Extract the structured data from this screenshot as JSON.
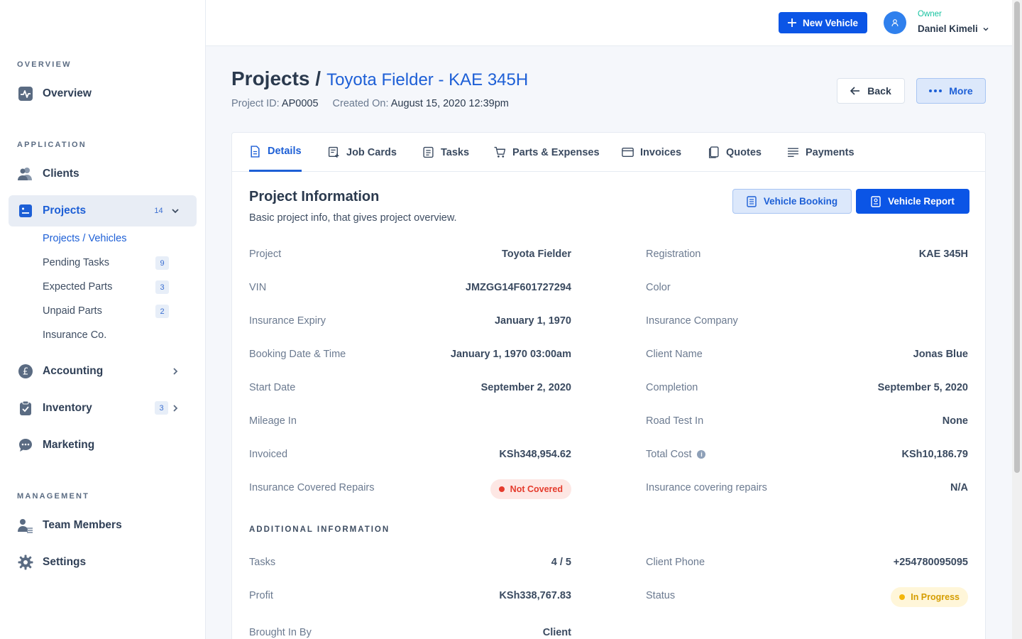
{
  "sidebar": {
    "sections": {
      "overview": "OVERVIEW",
      "application": "APPLICATION",
      "management": "MANAGEMENT"
    },
    "items": {
      "overview": "Overview",
      "clients": "Clients",
      "projects": "Projects",
      "projects_count": "14",
      "accounting": "Accounting",
      "inventory": "Inventory",
      "inventory_count": "3",
      "marketing": "Marketing",
      "team_members": "Team Members",
      "settings": "Settings"
    },
    "sub_items": [
      {
        "label": "Projects / Vehicles",
        "count": ""
      },
      {
        "label": "Pending Tasks",
        "count": "9"
      },
      {
        "label": "Expected Parts",
        "count": "3"
      },
      {
        "label": "Unpaid Parts",
        "count": "2"
      },
      {
        "label": "Insurance Co.",
        "count": ""
      }
    ]
  },
  "topbar": {
    "new_vehicle": "New Vehicle",
    "user_role": "Owner",
    "user_name": "Daniel Kimeli"
  },
  "header": {
    "title": "Projects /",
    "subtitle": "Toyota Fielder - KAE 345H",
    "project_id_label": "Project ID:",
    "project_id": "AP0005",
    "created_label": "Created On:",
    "created_on": "August 15, 2020 12:39pm",
    "back": "Back",
    "more": "More"
  },
  "tabs": [
    "Details",
    "Job Cards",
    "Tasks",
    "Parts & Expenses",
    "Invoices",
    "Quotes",
    "Payments"
  ],
  "info": {
    "title": "Project Information",
    "description": "Basic project info, that gives project overview.",
    "vehicle_booking": "Vehicle Booking",
    "vehicle_report": "Vehicle Report",
    "left": [
      {
        "label": "Project",
        "value": "Toyota Fielder"
      },
      {
        "label": "VIN",
        "value": "JMZGG14F601727294"
      },
      {
        "label": "Insurance Expiry",
        "value": "January 1, 1970"
      },
      {
        "label": "Booking Date & Time",
        "value": "January 1, 1970 03:00am"
      },
      {
        "label": "Start Date",
        "value": "September 2, 2020"
      },
      {
        "label": "Mileage In",
        "value": ""
      },
      {
        "label": "Invoiced",
        "value": "KSh348,954.62"
      },
      {
        "label": "Insurance Covered Repairs",
        "value": "Not Covered"
      }
    ],
    "right": [
      {
        "label": "Registration",
        "value": "KAE 345H"
      },
      {
        "label": "Color",
        "value": ""
      },
      {
        "label": "Insurance Company",
        "value": ""
      },
      {
        "label": "Client Name",
        "value": "Jonas Blue"
      },
      {
        "label": "Completion",
        "value": "September 5, 2020"
      },
      {
        "label": "Road Test In",
        "value": "None"
      },
      {
        "label": "Total Cost",
        "value": "KSh10,186.79"
      },
      {
        "label": "Insurance covering repairs",
        "value": "N/A"
      }
    ],
    "additional_title": "ADDITIONAL INFORMATION",
    "additional_left": [
      {
        "label": "Tasks",
        "value": "4 / 5"
      },
      {
        "label": "Profit",
        "value": "KSh338,767.83"
      },
      {
        "label": "Brought In By",
        "value": "Client"
      }
    ],
    "additional_right": [
      {
        "label": "Client Phone",
        "value": "+254780095095"
      },
      {
        "label": "Status",
        "value": "In Progress"
      }
    ]
  },
  "colors": {
    "primary": "#0b55e6",
    "accent_text": "#1d5fd6",
    "owner_green": "#16c3a0",
    "danger": "#e53b2c",
    "warning": "#f3b60b"
  }
}
